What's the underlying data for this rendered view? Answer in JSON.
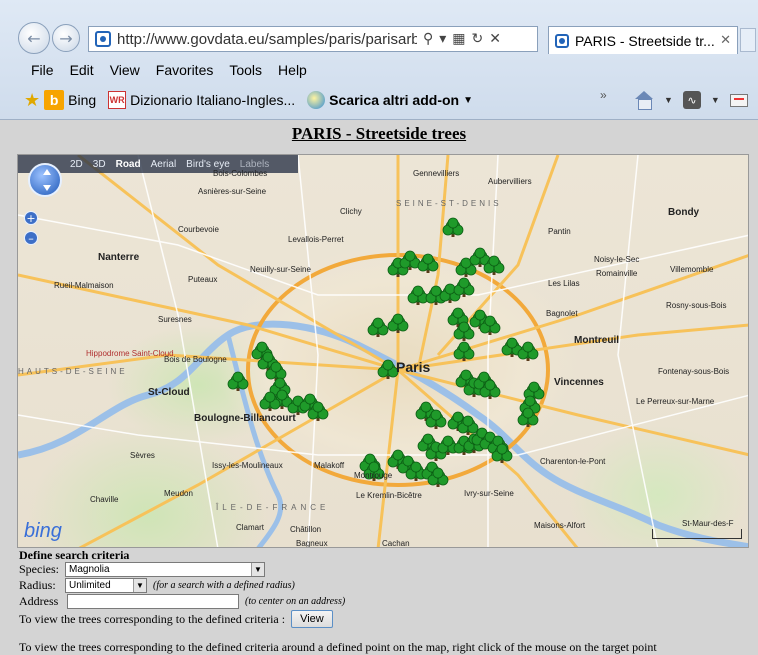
{
  "browser": {
    "url": "http://www.govdata.eu/samples/paris/parisarbre",
    "tab_title": "PARIS - Streetside tr...",
    "menu": [
      "File",
      "Edit",
      "View",
      "Favorites",
      "Tools",
      "Help"
    ],
    "favorites": {
      "bing": "Bing",
      "dizionario": "Dizionario Italiano-Ingles...",
      "addons": "Scarica altri add-on"
    }
  },
  "page": {
    "title": "PARIS - Streetside trees"
  },
  "map": {
    "toolbar": [
      "2D",
      "3D",
      "Road",
      "Aerial",
      "Bird's eye",
      "Labels"
    ],
    "selected_view": "Road",
    "logo": "bing",
    "center_label": "Paris",
    "labels": [
      {
        "t": "Bois-Colombes"
      },
      {
        "t": "Asnières-sur-Seine"
      },
      {
        "t": "Gennevilliers"
      },
      {
        "t": "Aubervilliers"
      },
      {
        "t": "Clichy"
      },
      {
        "t": "Levallois-Perret"
      },
      {
        "t": "Courbevoie"
      },
      {
        "t": "Nanterre"
      },
      {
        "t": "Puteaux"
      },
      {
        "t": "Neuilly-sur-Seine"
      },
      {
        "t": "Rueil-Malmaison"
      },
      {
        "t": "Suresnes"
      },
      {
        "t": "Pantin"
      },
      {
        "t": "Bondy"
      },
      {
        "t": "Noisy-le-Sec"
      },
      {
        "t": "Romainville"
      },
      {
        "t": "Les Lilas"
      },
      {
        "t": "Bagnolet"
      },
      {
        "t": "Montreuil"
      },
      {
        "t": "Villemomble"
      },
      {
        "t": "Rosny-sous-Bois"
      },
      {
        "t": "Vincennes"
      },
      {
        "t": "Fontenay-sous-Bois"
      },
      {
        "t": "Le Perreux-sur-Marne"
      },
      {
        "t": "Boulogne-Billancourt"
      },
      {
        "t": "St-Cloud"
      },
      {
        "t": "Bois de Boulogne"
      },
      {
        "t": "Issy-les-Moulineaux"
      },
      {
        "t": "Malakoff"
      },
      {
        "t": "Montrouge"
      },
      {
        "t": "Sèvres"
      },
      {
        "t": "Meudon"
      },
      {
        "t": "Clamart"
      },
      {
        "t": "Châtillon"
      },
      {
        "t": "Bagneux"
      },
      {
        "t": "Le Kremlin-Bicêtre"
      },
      {
        "t": "Ivry-sur-Seine"
      },
      {
        "t": "Charenton-le-Pont"
      },
      {
        "t": "Maisons-Alfort"
      },
      {
        "t": "St-Maur-des-F"
      },
      {
        "t": "Cachan"
      },
      {
        "t": "Chaville"
      },
      {
        "t": "Hippodrome Saint-Cloud"
      },
      {
        "t": "ÎLE-DE-FRANCE"
      },
      {
        "t": "HAUTS-DE-SEINE"
      },
      {
        "t": "SEINE-ST-DENIS"
      }
    ],
    "trees": 58
  },
  "form": {
    "heading": "Define search criteria",
    "species_label": "Species:",
    "species_value": "Magnolia",
    "radius_label": "Radius:",
    "radius_value": "Unlimited",
    "radius_hint": "(for a search with a defined radius)",
    "address_label": "Address",
    "address_value": "",
    "address_hint": "(to center on an address)",
    "view_text": "To view the trees corresponding to the defined criteria :",
    "view_button": "View",
    "footer_text": "To view the trees corresponding to the defined criteria around a defined point on the map, right click of the mouse on the target point"
  }
}
